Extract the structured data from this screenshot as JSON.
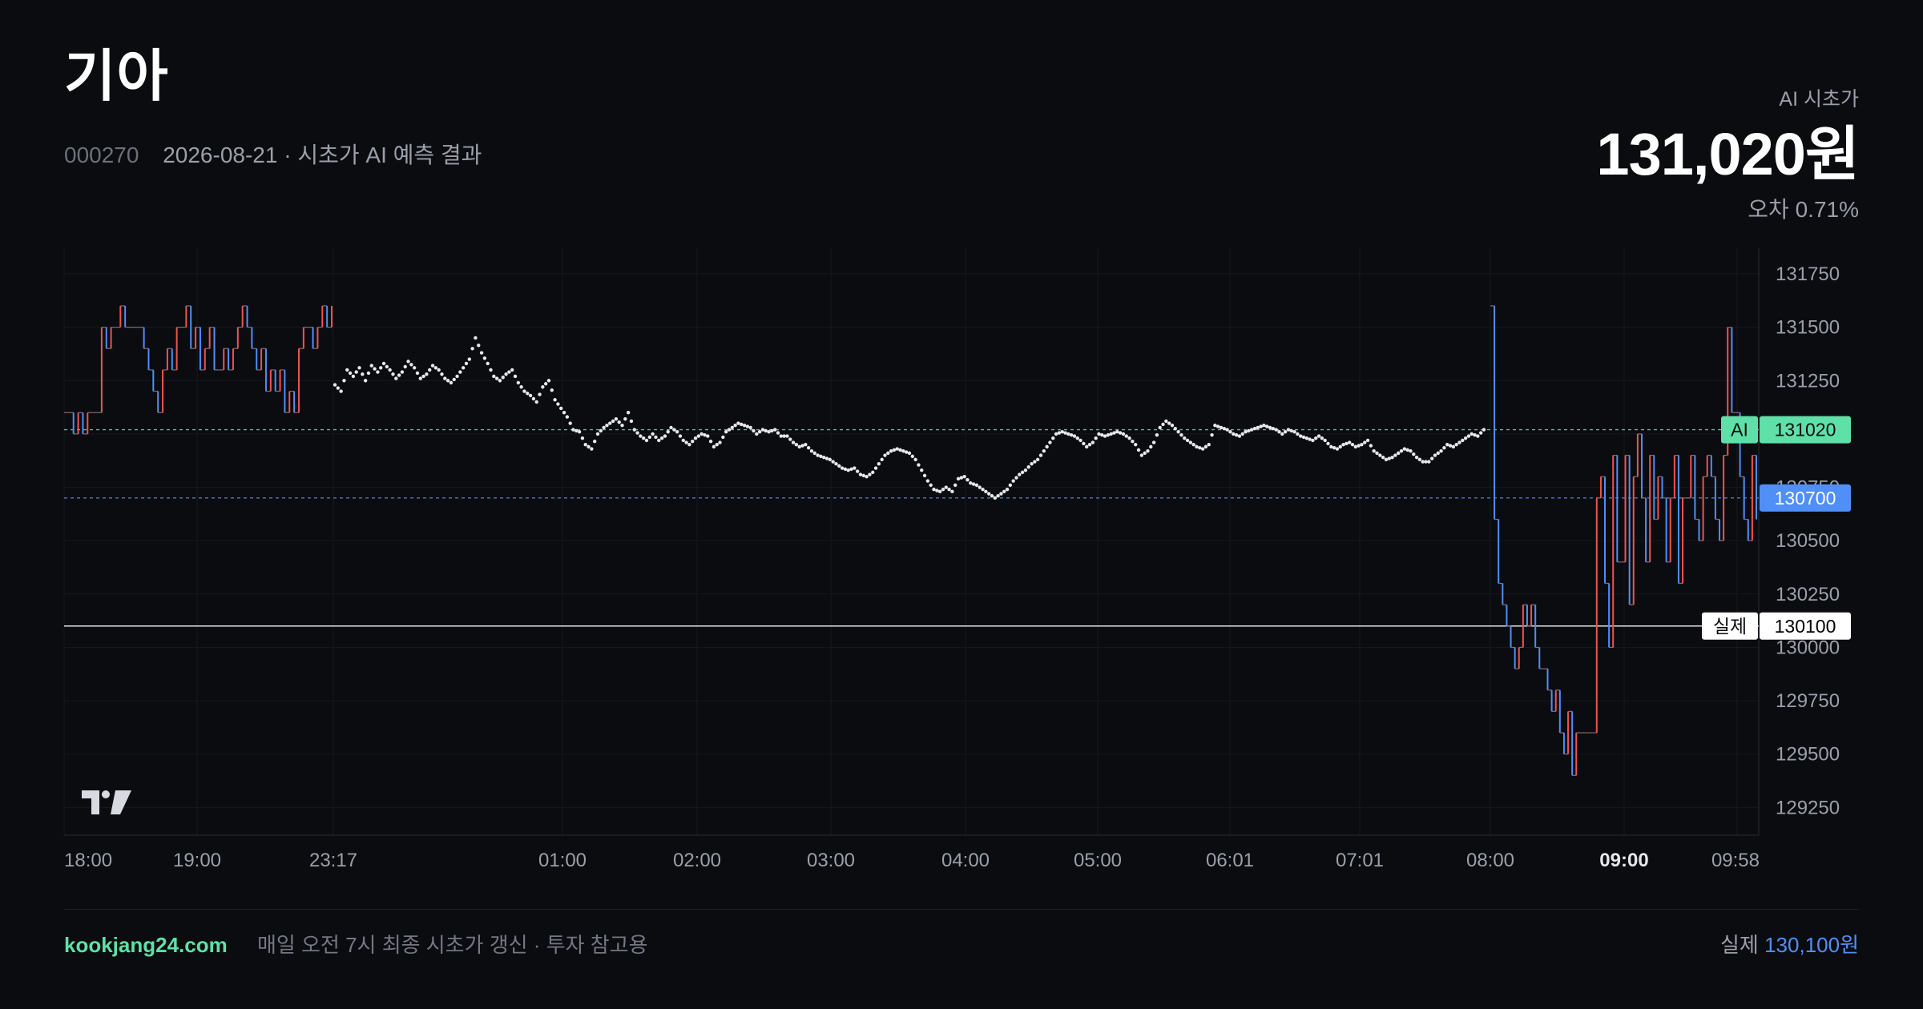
{
  "header": {
    "title": "기아",
    "code": "000270",
    "subtitle": "2026-08-21 · 시초가 AI 예측 결과"
  },
  "prediction": {
    "label": "AI 시초가",
    "value": "131,020원",
    "error": "오차 0.71%"
  },
  "footer": {
    "site": "kookjang24.com",
    "note": "매일 오전 7시 최종 시초가 갱신 · 투자 참고용",
    "actual_label": "실제",
    "actual_value": "130,100원"
  },
  "colors": {
    "background": "#0b0c10",
    "up": "#ef5350",
    "down": "#4f8ff7",
    "ai_line": "#5ee0a8",
    "prev_line": "#4f8ff7",
    "actual_line": "#ffffff",
    "dots": "#e6e8ee"
  },
  "icons": {
    "logo": "tradingview-logo"
  },
  "chart_data": {
    "type": "line",
    "y_ticks": [
      131750,
      131500,
      131250,
      131000,
      130750,
      130500,
      130250,
      130000,
      129750,
      129500,
      129250
    ],
    "ylim": [
      129120,
      131870
    ],
    "x_labels": [
      {
        "label": "18:00",
        "bold": false
      },
      {
        "label": "19:00",
        "bold": false
      },
      {
        "label": "23:17",
        "bold": false
      },
      {
        "label": "01:00",
        "bold": false
      },
      {
        "label": "02:00",
        "bold": false
      },
      {
        "label": "03:00",
        "bold": false
      },
      {
        "label": "04:00",
        "bold": false
      },
      {
        "label": "05:00",
        "bold": false
      },
      {
        "label": "06:01",
        "bold": false
      },
      {
        "label": "07:01",
        "bold": false
      },
      {
        "label": "08:00",
        "bold": false
      },
      {
        "label": "09:00",
        "bold": true
      },
      {
        "label": "09:58",
        "bold": false
      }
    ],
    "grid": true,
    "reference_lines": [
      {
        "name": "AI",
        "value": 131020,
        "label": "131020",
        "style": "dashed",
        "color": "#5ee0a8"
      },
      {
        "name": "prev",
        "value": 130700,
        "label": "130700",
        "style": "dashed",
        "color": "#4f8ff7"
      },
      {
        "name": "실제",
        "value": 130100,
        "label": "130100",
        "style": "solid",
        "color": "#ffffff"
      }
    ],
    "pre_market_ticks": [
      131100,
      131100,
      131000,
      131100,
      131000,
      131100,
      131100,
      131100,
      131500,
      131400,
      131500,
      131500,
      131600,
      131500,
      131500,
      131500,
      131500,
      131400,
      131300,
      131200,
      131100,
      131300,
      131400,
      131300,
      131500,
      131500,
      131600,
      131400,
      131500,
      131300,
      131400,
      131500,
      131300,
      131300,
      131400,
      131300,
      131400,
      131500,
      131600,
      131500,
      131400,
      131300,
      131400,
      131200,
      131300,
      131200,
      131300,
      131100,
      131200,
      131100,
      131400,
      131500,
      131500,
      131400,
      131500,
      131600,
      131500,
      131600
    ],
    "ai_path": [
      131230,
      131200,
      131300,
      131270,
      131310,
      131250,
      131320,
      131290,
      131330,
      131300,
      131260,
      131290,
      131340,
      131310,
      131260,
      131280,
      131320,
      131300,
      131260,
      131240,
      131270,
      131310,
      131350,
      131450,
      131380,
      131330,
      131270,
      131250,
      131280,
      131300,
      131240,
      131200,
      131180,
      131150,
      131220,
      131250,
      131160,
      131120,
      131080,
      131020,
      131010,
      130950,
      130930,
      131000,
      131030,
      131050,
      131070,
      131040,
      131100,
      131020,
      130990,
      130970,
      131000,
      130970,
      130990,
      131030,
      131010,
      130970,
      130950,
      130980,
      131000,
      130990,
      130940,
      130960,
      131010,
      131030,
      131050,
      131040,
      131030,
      131000,
      131020,
      131010,
      131020,
      130990,
      130990,
      130960,
      130940,
      130950,
      130920,
      130900,
      130890,
      130880,
      130860,
      130840,
      130830,
      130840,
      130810,
      130800,
      130820,
      130860,
      130900,
      130920,
      130930,
      130920,
      130910,
      130880,
      130830,
      130780,
      130740,
      130730,
      130750,
      130730,
      130790,
      130800,
      130770,
      130760,
      130740,
      130720,
      130700,
      130720,
      130740,
      130780,
      130810,
      130830,
      130860,
      130880,
      130920,
      130960,
      131000,
      131010,
      131000,
      130990,
      130970,
      130940,
      130960,
      131000,
      130990,
      131000,
      131010,
      131000,
      130980,
      130950,
      130900,
      130920,
      130960,
      131030,
      131060,
      131040,
      131010,
      130980,
      130960,
      130940,
      130930,
      130950,
      131040,
      131030,
      131020,
      131000,
      130990,
      131010,
      131020,
      131030,
      131040,
      131030,
      131020,
      131000,
      131020,
      131010,
      130990,
      130980,
      130970,
      130990,
      130970,
      130940,
      130930,
      130950,
      130960,
      130940,
      130950,
      130970,
      130920,
      130900,
      130880,
      130890,
      130910,
      130930,
      130920,
      130890,
      130870,
      130870,
      130900,
      130920,
      130950,
      130940,
      130960,
      130980,
      131000,
      130990,
      131020
    ],
    "market_ticks": [
      131600,
      130600,
      130300,
      130200,
      130100,
      130000,
      129900,
      130000,
      130200,
      130100,
      130200,
      130000,
      129900,
      129900,
      129800,
      129700,
      129800,
      129600,
      129500,
      129700,
      129400,
      129600,
      129600,
      129600,
      129600,
      129600,
      130700,
      130800,
      130300,
      130000,
      130900,
      130400,
      130400,
      130900,
      130200,
      130800,
      131000,
      130700,
      130400,
      130900,
      130600,
      130800,
      130700,
      130400,
      130700,
      130900,
      130300,
      130700,
      130700,
      130900,
      130600,
      130500,
      130800,
      130900,
      130800,
      130600,
      130500,
      130900,
      131500,
      131100,
      131100,
      130800,
      130600,
      130500,
      130900,
      130600
    ]
  }
}
